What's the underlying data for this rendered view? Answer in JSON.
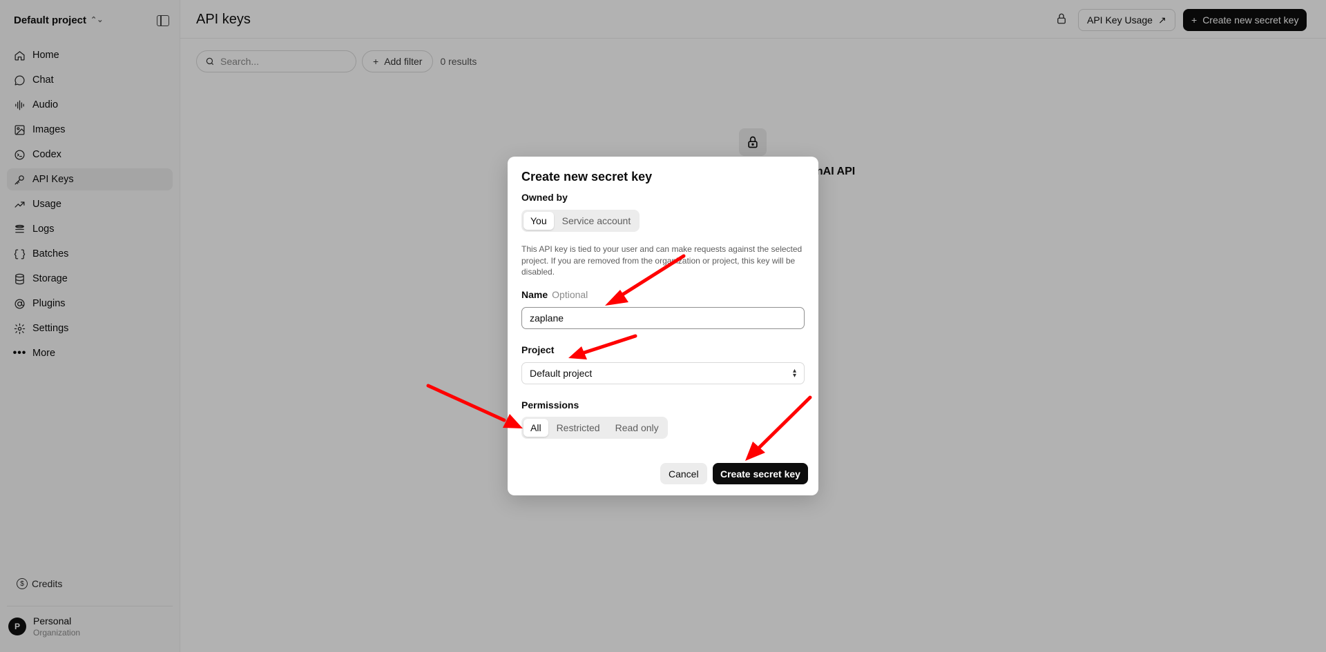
{
  "colors": {
    "accent": "#0d0d0d",
    "sidebar_bg": "#f9f9f9",
    "overlay": "rgba(0,0,0,0.30)",
    "annotation_arrow": "#ff0000"
  },
  "sidebar": {
    "project_switcher": "Default project",
    "items": [
      {
        "label": "Home",
        "icon": "home-icon"
      },
      {
        "label": "Chat",
        "icon": "chat-icon"
      },
      {
        "label": "Audio",
        "icon": "audio-icon"
      },
      {
        "label": "Images",
        "icon": "image-icon"
      },
      {
        "label": "Codex",
        "icon": "codex-icon"
      },
      {
        "label": "API Keys",
        "icon": "key-icon",
        "active": true
      },
      {
        "label": "Usage",
        "icon": "usage-icon"
      },
      {
        "label": "Logs",
        "icon": "logs-icon"
      },
      {
        "label": "Batches",
        "icon": "batches-icon"
      },
      {
        "label": "Storage",
        "icon": "storage-icon"
      },
      {
        "label": "Plugins",
        "icon": "plugins-icon"
      },
      {
        "label": "Settings",
        "icon": "settings-icon"
      },
      {
        "label": "More",
        "icon": "more-icon"
      }
    ],
    "credits_label": "Credits",
    "org": {
      "avatar_letter": "P",
      "name": "Personal",
      "subtitle": "Organization"
    }
  },
  "header": {
    "title": "API keys",
    "usage_button": "API Key Usage",
    "create_button": "Create new secret key"
  },
  "toolbar": {
    "search_placeholder": "Search...",
    "add_filter": "Add filter",
    "results": "0 results"
  },
  "empty_state": {
    "title_partial": "enAI API"
  },
  "modal": {
    "title": "Create new secret key",
    "owned_by_label": "Owned by",
    "owned_by_options": [
      "You",
      "Service account"
    ],
    "owned_by_selected": "You",
    "description": "This API key is tied to your user and can make requests against the selected project. If you are removed from the organization or project, this key will be disabled.",
    "name_label": "Name",
    "name_optional": "Optional",
    "name_value": "zaplane",
    "project_label": "Project",
    "project_value": "Default project",
    "permissions_label": "Permissions",
    "permissions_options": [
      "All",
      "Restricted",
      "Read only"
    ],
    "permissions_selected": "All",
    "cancel_button": "Cancel",
    "create_button": "Create secret key"
  }
}
